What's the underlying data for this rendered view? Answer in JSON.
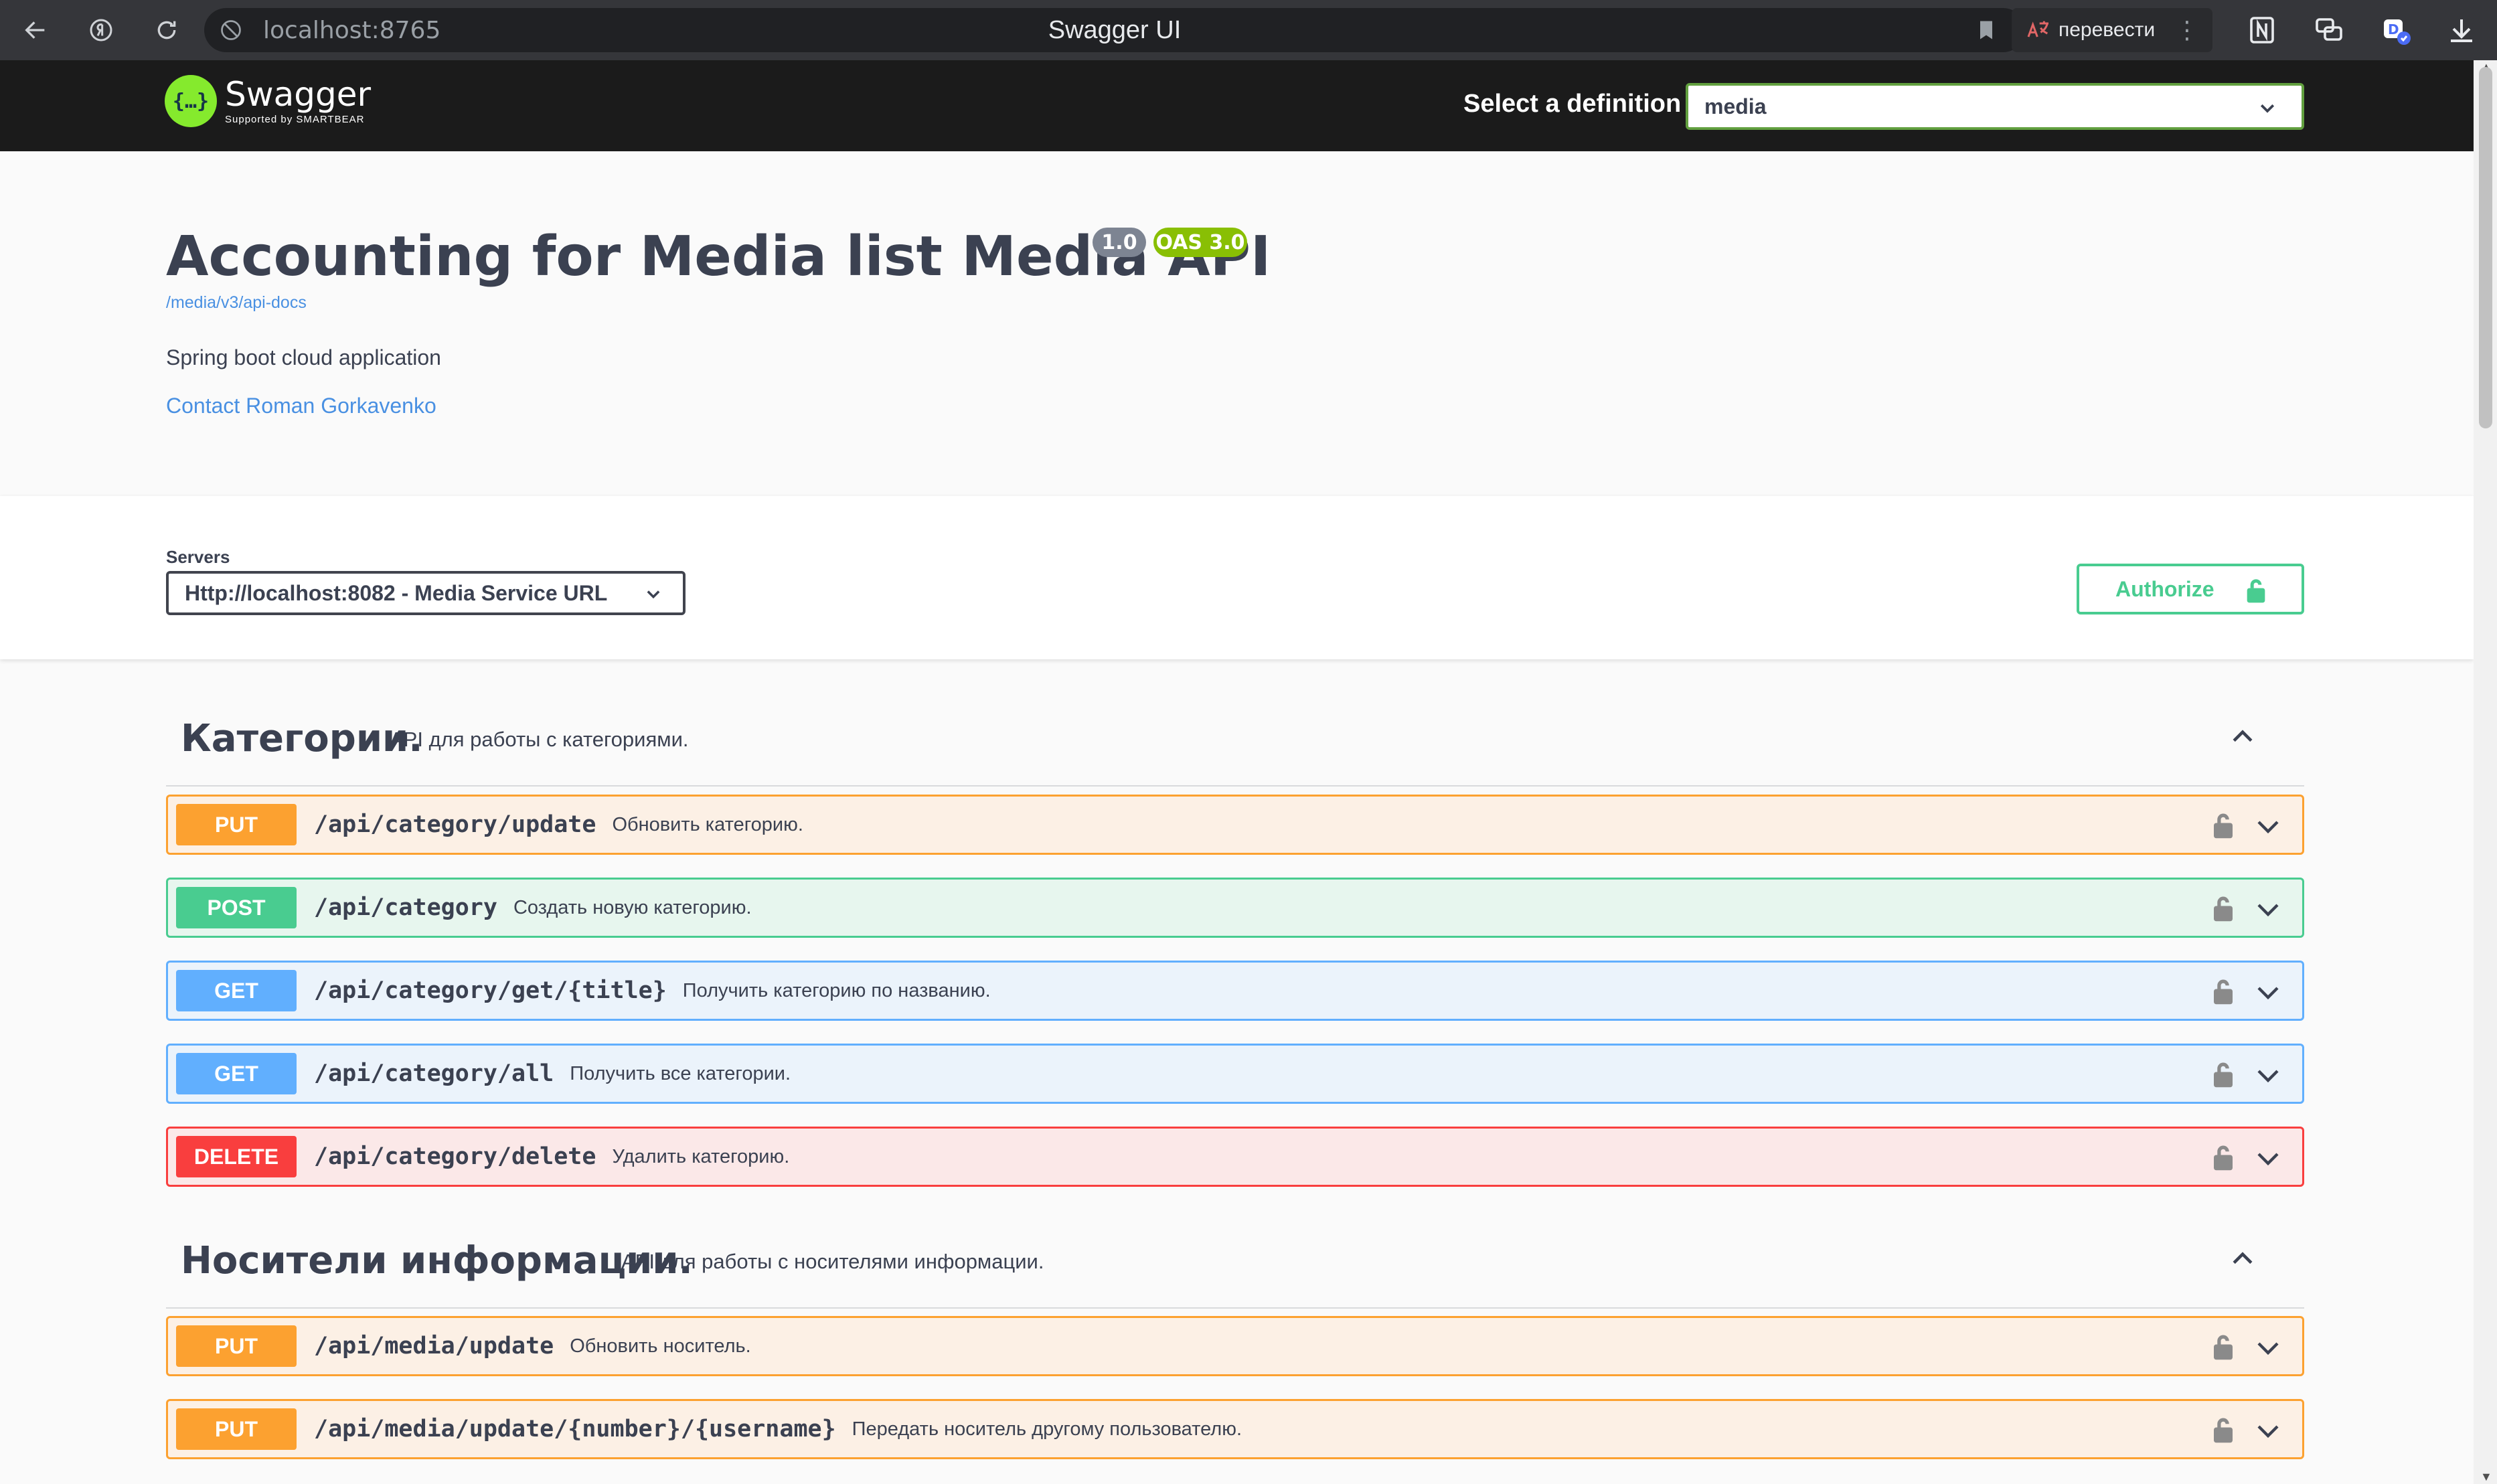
{
  "browser": {
    "url": "localhost:8765",
    "tab_title": "Swagger UI",
    "translate_label": "перевести"
  },
  "topbar": {
    "logo_text": "Swagger",
    "logo_sub": "Supported by SMARTBEAR",
    "select_label": "Select a definition",
    "definition_value": "media"
  },
  "info": {
    "title": "Accounting for Media list Media API",
    "version": "1.0",
    "oas": "OAS 3.0",
    "api_docs_url": "/media/v3/api-docs",
    "description": "Spring boot cloud application",
    "contact": "Contact Roman Gorkavenko"
  },
  "scheme": {
    "servers_label": "Servers",
    "server_value": "Http://localhost:8082 - Media Service URL",
    "authorize_label": "Authorize"
  },
  "tags": [
    {
      "name": "Категории.",
      "description": "API для работы с категориями.",
      "operations": [
        {
          "method": "PUT",
          "path": "/api/category/update",
          "summary": "Обновить категорию."
        },
        {
          "method": "POST",
          "path": "/api/category",
          "summary": "Создать новую категорию."
        },
        {
          "method": "GET",
          "path": "/api/category/get/{title}",
          "summary": "Получить категорию по названию."
        },
        {
          "method": "GET",
          "path": "/api/category/all",
          "summary": "Получить все категории."
        },
        {
          "method": "DELETE",
          "path": "/api/category/delete",
          "summary": "Удалить категорию."
        }
      ]
    },
    {
      "name": "Носители информации.",
      "description": "API для работы с носителями информации.",
      "operations": [
        {
          "method": "PUT",
          "path": "/api/media/update",
          "summary": "Обновить носитель."
        },
        {
          "method": "PUT",
          "path": "/api/media/update/{number}/{username}",
          "summary": "Передать носитель другому пользователю."
        }
      ]
    }
  ],
  "colors": {
    "put": "#fca130",
    "post": "#49cc90",
    "get": "#61affe",
    "delete": "#f93e3e",
    "swagger_green": "#85ea2d"
  }
}
